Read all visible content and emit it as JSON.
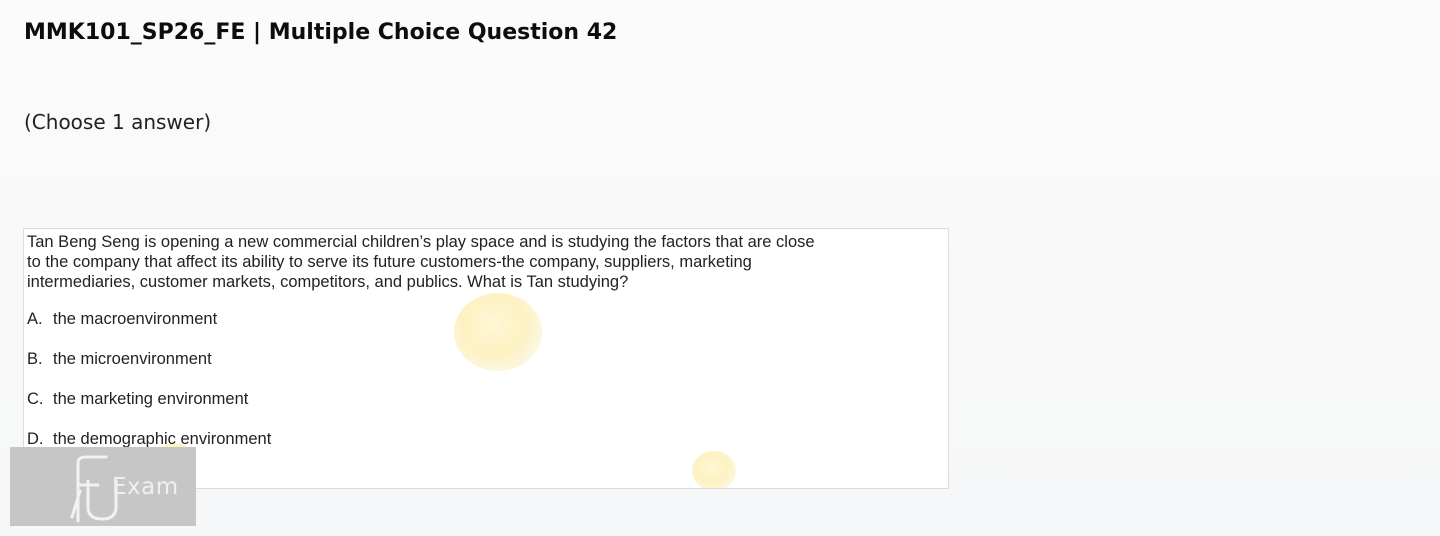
{
  "header": {
    "title": "MMK101_SP26_FE | Multiple Choice Question 42"
  },
  "instruction": "(Choose 1 answer)",
  "question": {
    "stem_lines": [
      "Tan Beng Seng is opening a new commercial children’s play space and is studying the factors that are close",
      "to the company that affect its ability to serve its future customers-the company, suppliers, marketing",
      "intermediaries, customer markets, competitors, and publics. What is Tan studying?"
    ],
    "options": [
      {
        "letter": "A.",
        "text": "the macroenvironment"
      },
      {
        "letter": "B.",
        "text": "the microenvironment"
      },
      {
        "letter": "C.",
        "text": "the marketing environment"
      },
      {
        "letter": "D.",
        "text": "the demographic environment"
      }
    ]
  },
  "logo": {
    "text": "Exam",
    "mark": "FU"
  }
}
